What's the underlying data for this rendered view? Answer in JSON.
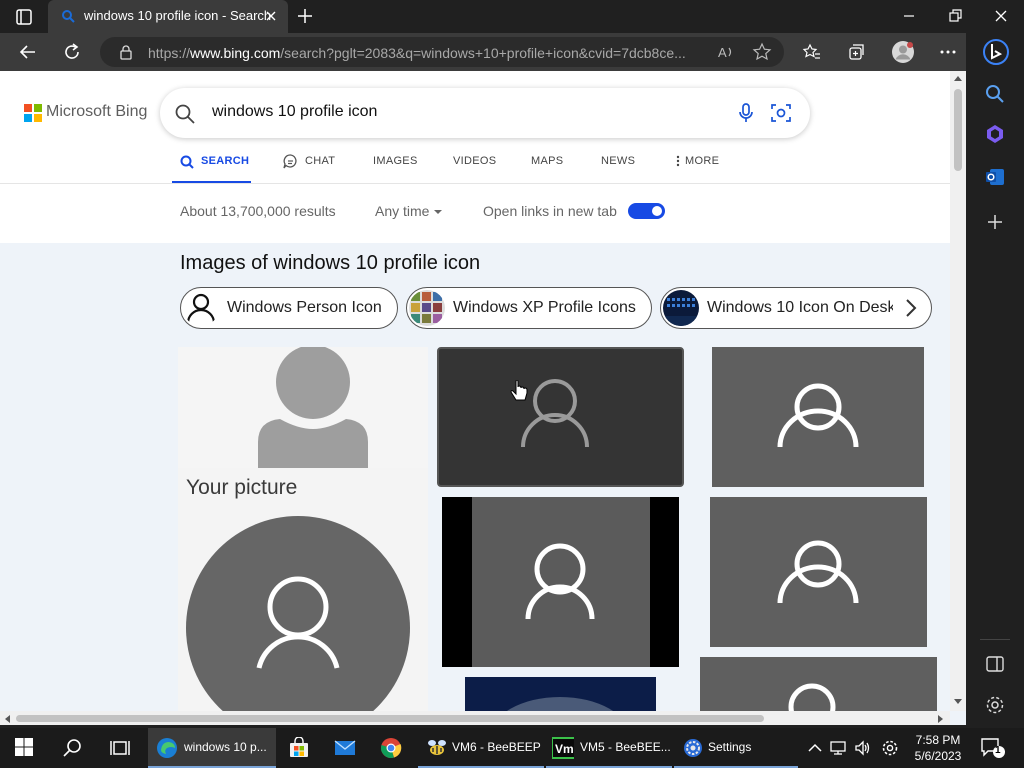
{
  "browser": {
    "tab_title": "windows 10 profile icon - Search",
    "url_prefix": "https://",
    "url_domain": "www.bing.com",
    "url_rest": "/search?pglt=2083&q=windows+10+profile+icon&cvid=7dcb8ce..."
  },
  "bing": {
    "logo_text": "Microsoft Bing",
    "query": "windows 10 profile icon",
    "scopes": [
      "SEARCH",
      "CHAT",
      "IMAGES",
      "VIDEOS",
      "MAPS",
      "NEWS",
      "MORE"
    ],
    "results_count": "About 13,700,000 results",
    "time_filter": "Any time",
    "open_links_label": "Open links in new tab",
    "open_links_enabled": true
  },
  "images": {
    "heading": "Images of windows 10 profile icon",
    "chips": [
      "Windows Person Icon",
      "Windows XP Profile Icons",
      "Windows 10 Icon On Deskt"
    ],
    "your_picture_caption": "Your picture"
  },
  "taskbar": {
    "items": [
      {
        "label": "windows 10 p...",
        "icon": "edge-icon"
      },
      {
        "label": "",
        "icon": "store-icon"
      },
      {
        "label": "",
        "icon": "mail-icon"
      },
      {
        "label": "",
        "icon": "chrome-icon"
      },
      {
        "label": "VM6 - BeeBEEP",
        "icon": "beebeep-icon"
      },
      {
        "label": "VM5 - BeeBEE...",
        "icon": "vmware-icon"
      },
      {
        "label": "Settings",
        "icon": "settings-icon"
      }
    ],
    "time": "7:58 PM",
    "date": "5/6/2023",
    "notification_count": "1"
  },
  "colors": {
    "accent": "#174ae4",
    "page_bg": "#eef3f9",
    "tile_dark": "#333333",
    "tile_gray": "#5f5f5f"
  }
}
